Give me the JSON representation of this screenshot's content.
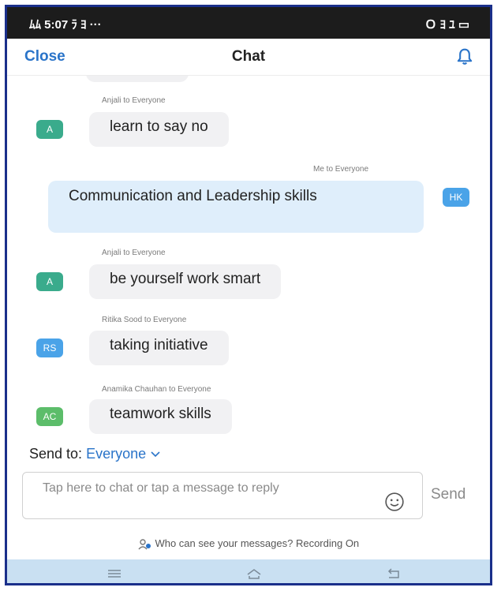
{
  "status_bar": {
    "left": "ﾑﾑ 5:07 ﾗ ﾖ ···",
    "right": "Ｏ ﾖ ﾕ ▭"
  },
  "header": {
    "close_label": "Close",
    "title": "Chat"
  },
  "messages": [
    {
      "sender": "Anjali to Everyone",
      "avatar": "A",
      "text": "learn to say no"
    },
    {
      "sender": "Me to Everyone",
      "avatar": "HK",
      "text": "Communication and Leadership skills"
    },
    {
      "sender": "Anjali to Everyone",
      "avatar": "A",
      "text": "be yourself work smart"
    },
    {
      "sender": "Ritika Sood to Everyone",
      "avatar": "RS",
      "text": "taking initiative"
    },
    {
      "sender": "Anamika Chauhan to Everyone",
      "avatar": "AC",
      "text": "teamwork skills"
    }
  ],
  "send_to": {
    "label": "Send to:",
    "target": "Everyone"
  },
  "input": {
    "placeholder": "Tap here to chat or tap a message to reply"
  },
  "send_label": "Send",
  "notice": "Who can see your messages? Recording On",
  "colors": {
    "accent": "#2a74c9",
    "avatar_green": "#3aab8c",
    "avatar_blue": "#4aa3e8",
    "avatar_lightgreen": "#5cbd6a",
    "my_bubble": "#dfeefb",
    "navbar": "#c9e0f2"
  },
  "icons": {
    "bell": "bell-icon",
    "emoji": "smiley-icon",
    "people": "people-icon",
    "menu": "menu-icon",
    "home": "home-icon",
    "back": "back-icon"
  }
}
